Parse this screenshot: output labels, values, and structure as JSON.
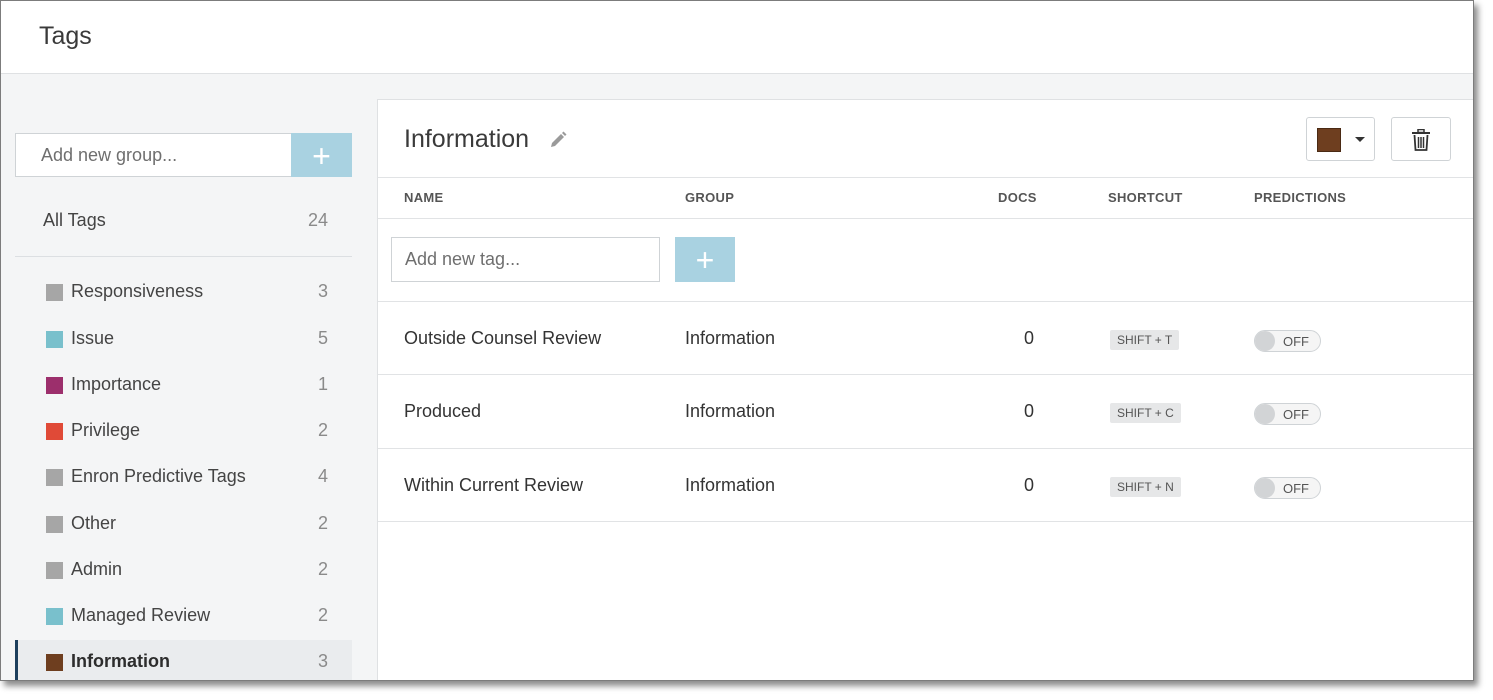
{
  "header": {
    "title": "Tags"
  },
  "sidebar": {
    "add_group_placeholder": "Add new group...",
    "add_group_label": "+",
    "all_tags": {
      "label": "All Tags",
      "count": "24"
    },
    "groups": [
      {
        "label": "Responsiveness",
        "count": "3",
        "color": "#a6a6a6"
      },
      {
        "label": "Issue",
        "count": "5",
        "color": "#79c0cc"
      },
      {
        "label": "Importance",
        "count": "1",
        "color": "#9c2f6c"
      },
      {
        "label": "Privilege",
        "count": "2",
        "color": "#e04a37"
      },
      {
        "label": "Enron Predictive Tags",
        "count": "4",
        "color": "#a6a6a6"
      },
      {
        "label": "Other",
        "count": "2",
        "color": "#a6a6a6"
      },
      {
        "label": "Admin",
        "count": "2",
        "color": "#a6a6a6"
      },
      {
        "label": "Managed Review",
        "count": "2",
        "color": "#79c0cc"
      },
      {
        "label": "Information",
        "count": "3",
        "color": "#6e3e1f",
        "active": true
      }
    ]
  },
  "main": {
    "title": "Information",
    "color": "#6e3e1f",
    "columns": {
      "name": "NAME",
      "group": "GROUP",
      "docs": "DOCS",
      "shortcut": "SHORTCUT",
      "predictions": "PREDICTIONS"
    },
    "add_tag_placeholder": "Add new tag...",
    "add_tag_label": "+",
    "rows": [
      {
        "name": "Outside Counsel Review",
        "group": "Information",
        "docs": "0",
        "shortcut": "SHIFT + T",
        "prediction": "OFF"
      },
      {
        "name": "Produced",
        "group": "Information",
        "docs": "0",
        "shortcut": "SHIFT + C",
        "prediction": "OFF"
      },
      {
        "name": "Within Current Review",
        "group": "Information",
        "docs": "0",
        "shortcut": "SHIFT + N",
        "prediction": "OFF"
      }
    ]
  }
}
